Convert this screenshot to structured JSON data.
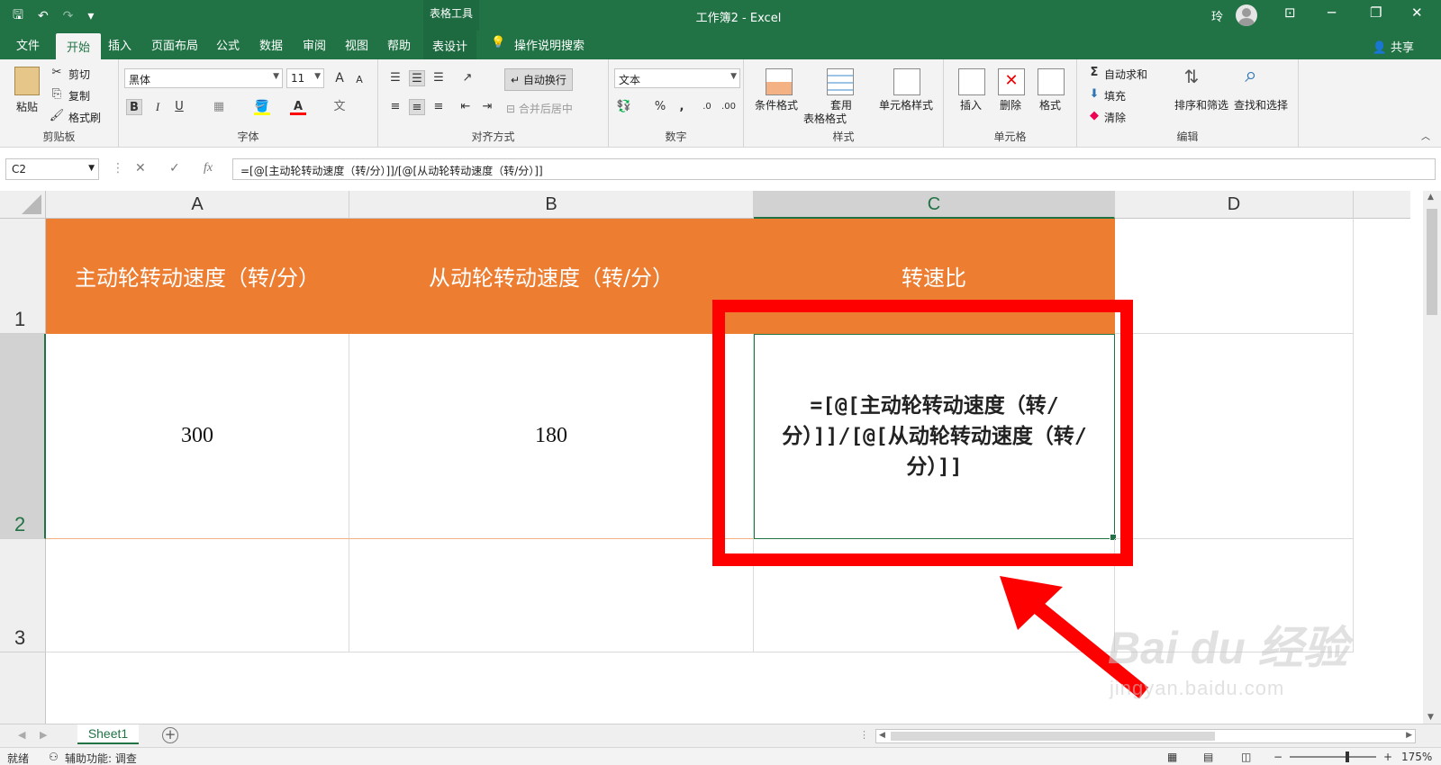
{
  "titlebar": {
    "qat_save": "🖫",
    "qat_undo": "↶",
    "qat_redo": "↷",
    "qat_more": "▾",
    "context_tool": "表格工具",
    "doc_title": "工作簿2 - Excel",
    "user_name": "玲",
    "win_ribbon_opts": "⊡",
    "win_min": "─",
    "win_max": "❐",
    "win_close": "✕"
  },
  "tabs": {
    "file": "文件",
    "home": "开始",
    "insert": "插入",
    "page_layout": "页面布局",
    "formulas": "公式",
    "data": "数据",
    "review": "审阅",
    "view": "视图",
    "help": "帮助",
    "table_design": "表设计",
    "tell_me": "操作说明搜索",
    "share": "共享"
  },
  "ribbon": {
    "clipboard": {
      "label": "剪贴板",
      "paste": "粘贴",
      "cut": "剪切",
      "copy": "复制",
      "format_painter": "格式刷"
    },
    "font": {
      "label": "字体",
      "font_name": "黑体",
      "font_size": "11",
      "grow": "A",
      "shrink": "A",
      "bold": "B",
      "italic": "I",
      "underline": "U"
    },
    "alignment": {
      "label": "对齐方式",
      "wrap_text": "自动换行",
      "merge_center": "合并后居中"
    },
    "number": {
      "label": "数字",
      "format": "文本",
      "percent": "%",
      "comma": ","
    },
    "styles": {
      "label": "样式",
      "conditional": "条件格式",
      "table_format_1": "套用",
      "table_format_2": "表格格式",
      "cell_styles": "单元格样式"
    },
    "cells": {
      "label": "单元格",
      "insert": "插入",
      "delete": "删除",
      "format": "格式"
    },
    "editing": {
      "label": "编辑",
      "autosum": "自动求和",
      "fill": "填充",
      "clear": "清除",
      "sort_filter": "排序和筛选",
      "find_select": "查找和选择"
    }
  },
  "formula_bar": {
    "name_box": "C2",
    "cancel": "✕",
    "enter": "✓",
    "fx": "fx",
    "formula": "=[@[主动轮转动速度（转/分）]]/[@[从动轮转动速度（转/分）]]"
  },
  "grid": {
    "columns": [
      "A",
      "B",
      "C",
      "D"
    ],
    "rows": [
      "1",
      "2",
      "3"
    ],
    "header_cells": [
      "主动轮转动速度（转/分）",
      "从动轮转动速度（转/分）",
      "转速比"
    ],
    "row2": {
      "a": "300",
      "b": "180",
      "c": "=[@[主动轮转动速度（转/分）]]/[@[从动轮转动速度（转/分）]]"
    }
  },
  "sheets": {
    "active": "Sheet1",
    "add": "+"
  },
  "statusbar": {
    "ready": "就绪",
    "accessibility": "辅助功能: 调查",
    "zoom": "175%",
    "zoom_minus": "−",
    "zoom_plus": "+"
  },
  "watermark": {
    "line1": "Bai du 经验",
    "line2": "jingyan.baidu.com"
  },
  "colors": {
    "excel_green": "#217346",
    "header_orange": "#ed7d31",
    "annotation_red": "#ff0000"
  }
}
